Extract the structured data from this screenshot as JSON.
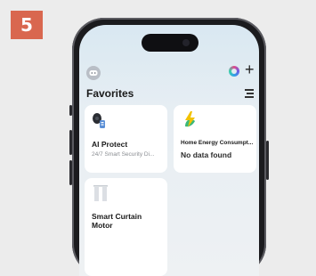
{
  "step": {
    "number": "5"
  },
  "header": {
    "title": "Favorites"
  },
  "cards": [
    {
      "title": "AI Protect",
      "subtitle": "24/7 Smart Security Di..."
    },
    {
      "title": "Home Energy Consumpt...",
      "subtitle": "No data found"
    },
    {
      "title": "Smart Curtain Motor"
    }
  ],
  "colors": {
    "badge": "#d9674f",
    "energy_icon": "#f2c200",
    "energy_leaf": "#3cb878"
  },
  "icons": [
    "avatar-icon",
    "assistant-icon",
    "plus-icon",
    "menu-icon",
    "camera-icon",
    "energy-icon",
    "curtain-icon"
  ]
}
